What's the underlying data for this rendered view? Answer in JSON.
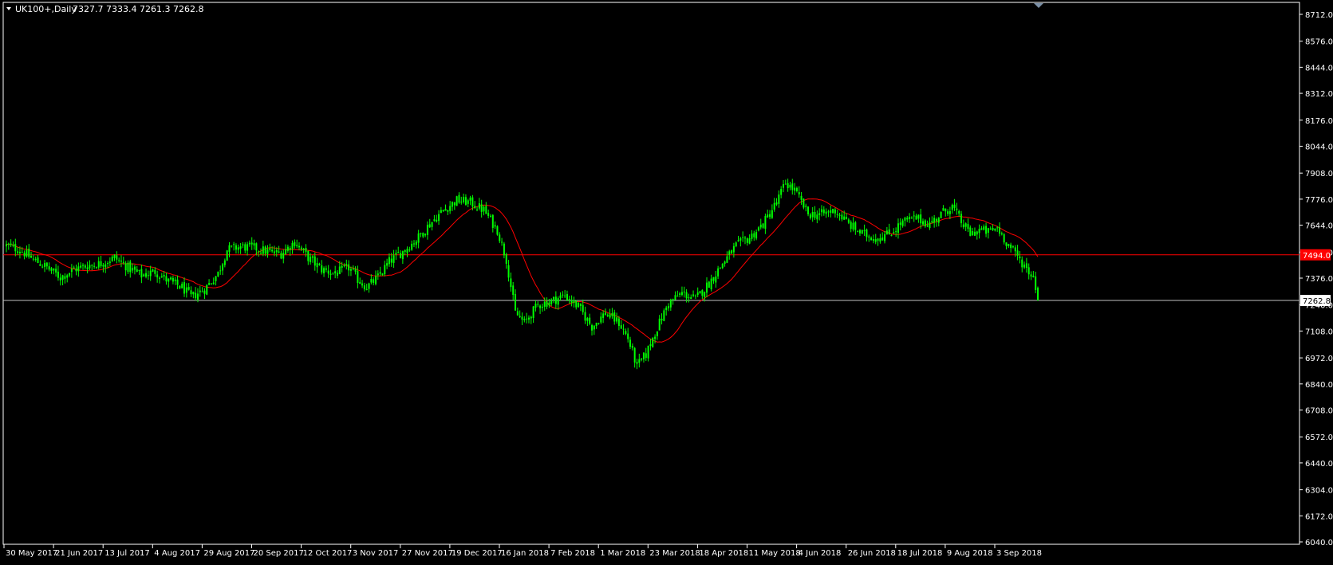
{
  "header": {
    "symbol_timeframe": "UK100+,Daily",
    "ohlc": "7327.7 7333.4 7261.3 7262.8"
  },
  "colors": {
    "background": "#000000",
    "axis": "#ffffff",
    "candle": "#00ff00",
    "ma": "#ff0000",
    "level_line": "#ff0000",
    "bid_line": "#c0c0c0",
    "price_label_red_bg": "#ff0000"
  },
  "chart_data": {
    "type": "candlestick",
    "title": "",
    "xlabel": "",
    "ylabel": "",
    "ylim": [
      6040,
      8780
    ],
    "y_ticks": [
      "8712.0",
      "8576.0",
      "8444.0",
      "8312.0",
      "8176.0",
      "8044.0",
      "7908.0",
      "7776.0",
      "7644.0",
      "7508.0",
      "7376.0",
      "7240.0",
      "7108.0",
      "6972.0",
      "6840.0",
      "6708.0",
      "6572.0",
      "6440.0",
      "6304.0",
      "6172.0",
      "6040.0"
    ],
    "x_labels": [
      "30 May 2017",
      "21 Jun 2017",
      "13 Jul 2017",
      "4 Aug 2017",
      "29 Aug 2017",
      "20 Sep 2017",
      "12 Oct 2017",
      "3 Nov 2017",
      "27 Nov 2017",
      "19 Dec 2017",
      "16 Jan 2018",
      "7 Feb 2018",
      "1 Mar 2018",
      "23 Mar 2018",
      "18 Apr 2018",
      "11 May 2018",
      "4 Jun 2018",
      "26 Jun 2018",
      "18 Jul 2018",
      "9 Aug 2018",
      "3 Sep 2018"
    ],
    "anchors": [
      [
        0,
        7540
      ],
      [
        6,
        7520
      ],
      [
        12,
        7470
      ],
      [
        18,
        7430
      ],
      [
        24,
        7380
      ],
      [
        30,
        7420
      ],
      [
        36,
        7440
      ],
      [
        42,
        7450
      ],
      [
        48,
        7480
      ],
      [
        54,
        7430
      ],
      [
        60,
        7390
      ],
      [
        66,
        7410
      ],
      [
        72,
        7360
      ],
      [
        78,
        7330
      ],
      [
        82,
        7280
      ],
      [
        88,
        7320
      ],
      [
        94,
        7400
      ],
      [
        98,
        7520
      ],
      [
        104,
        7535
      ],
      [
        110,
        7530
      ],
      [
        116,
        7510
      ],
      [
        122,
        7500
      ],
      [
        128,
        7560
      ],
      [
        134,
        7480
      ],
      [
        140,
        7420
      ],
      [
        146,
        7400
      ],
      [
        152,
        7430
      ],
      [
        156,
        7370
      ],
      [
        160,
        7330
      ],
      [
        165,
        7380
      ],
      [
        170,
        7460
      ],
      [
        176,
        7510
      ],
      [
        182,
        7570
      ],
      [
        188,
        7650
      ],
      [
        194,
        7720
      ],
      [
        200,
        7770
      ],
      [
        206,
        7760
      ],
      [
        212,
        7720
      ],
      [
        218,
        7620
      ],
      [
        222,
        7470
      ],
      [
        226,
        7200
      ],
      [
        230,
        7150
      ],
      [
        236,
        7240
      ],
      [
        242,
        7260
      ],
      [
        248,
        7290
      ],
      [
        254,
        7230
      ],
      [
        260,
        7130
      ],
      [
        266,
        7200
      ],
      [
        272,
        7150
      ],
      [
        276,
        7070
      ],
      [
        280,
        6930
      ],
      [
        284,
        6990
      ],
      [
        288,
        7100
      ],
      [
        294,
        7250
      ],
      [
        300,
        7300
      ],
      [
        306,
        7270
      ],
      [
        312,
        7350
      ],
      [
        318,
        7450
      ],
      [
        324,
        7540
      ],
      [
        330,
        7580
      ],
      [
        336,
        7650
      ],
      [
        342,
        7760
      ],
      [
        346,
        7860
      ],
      [
        350,
        7820
      ],
      [
        356,
        7700
      ],
      [
        362,
        7700
      ],
      [
        368,
        7720
      ],
      [
        374,
        7650
      ],
      [
        380,
        7600
      ],
      [
        386,
        7580
      ],
      [
        392,
        7600
      ],
      [
        398,
        7660
      ],
      [
        404,
        7680
      ],
      [
        410,
        7650
      ],
      [
        416,
        7710
      ],
      [
        420,
        7740
      ],
      [
        424,
        7660
      ],
      [
        428,
        7600
      ],
      [
        432,
        7620
      ],
      [
        436,
        7610
      ],
      [
        440,
        7630
      ],
      [
        444,
        7560
      ],
      [
        448,
        7500
      ],
      [
        452,
        7440
      ],
      [
        456,
        7380
      ],
      [
        458,
        7290
      ]
    ],
    "ma": {
      "type": "moving-average"
    },
    "horizontal_levels": [
      {
        "value": 7494.0,
        "label": "7494.0",
        "color": "#ff0000"
      },
      {
        "value": 7262.8,
        "label": "7262.8",
        "color": "#c0c0c0"
      }
    ],
    "last_price": 7262.8,
    "grid": false,
    "legend": "none"
  }
}
